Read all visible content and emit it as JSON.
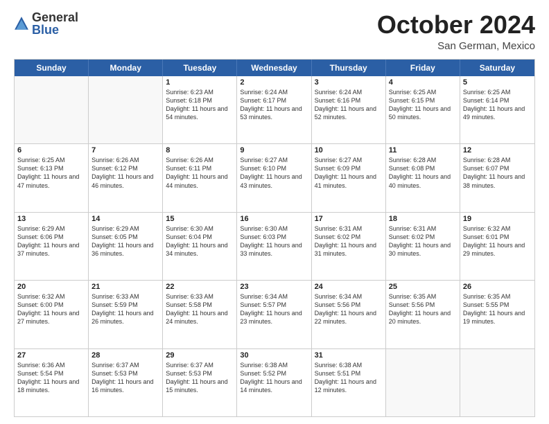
{
  "header": {
    "logo_general": "General",
    "logo_blue": "Blue",
    "month": "October 2024",
    "location": "San German, Mexico"
  },
  "weekdays": [
    "Sunday",
    "Monday",
    "Tuesday",
    "Wednesday",
    "Thursday",
    "Friday",
    "Saturday"
  ],
  "rows": [
    [
      {
        "day": "",
        "text": ""
      },
      {
        "day": "",
        "text": ""
      },
      {
        "day": "1",
        "text": "Sunrise: 6:23 AM\nSunset: 6:18 PM\nDaylight: 11 hours and 54 minutes."
      },
      {
        "day": "2",
        "text": "Sunrise: 6:24 AM\nSunset: 6:17 PM\nDaylight: 11 hours and 53 minutes."
      },
      {
        "day": "3",
        "text": "Sunrise: 6:24 AM\nSunset: 6:16 PM\nDaylight: 11 hours and 52 minutes."
      },
      {
        "day": "4",
        "text": "Sunrise: 6:25 AM\nSunset: 6:15 PM\nDaylight: 11 hours and 50 minutes."
      },
      {
        "day": "5",
        "text": "Sunrise: 6:25 AM\nSunset: 6:14 PM\nDaylight: 11 hours and 49 minutes."
      }
    ],
    [
      {
        "day": "6",
        "text": "Sunrise: 6:25 AM\nSunset: 6:13 PM\nDaylight: 11 hours and 47 minutes."
      },
      {
        "day": "7",
        "text": "Sunrise: 6:26 AM\nSunset: 6:12 PM\nDaylight: 11 hours and 46 minutes."
      },
      {
        "day": "8",
        "text": "Sunrise: 6:26 AM\nSunset: 6:11 PM\nDaylight: 11 hours and 44 minutes."
      },
      {
        "day": "9",
        "text": "Sunrise: 6:27 AM\nSunset: 6:10 PM\nDaylight: 11 hours and 43 minutes."
      },
      {
        "day": "10",
        "text": "Sunrise: 6:27 AM\nSunset: 6:09 PM\nDaylight: 11 hours and 41 minutes."
      },
      {
        "day": "11",
        "text": "Sunrise: 6:28 AM\nSunset: 6:08 PM\nDaylight: 11 hours and 40 minutes."
      },
      {
        "day": "12",
        "text": "Sunrise: 6:28 AM\nSunset: 6:07 PM\nDaylight: 11 hours and 38 minutes."
      }
    ],
    [
      {
        "day": "13",
        "text": "Sunrise: 6:29 AM\nSunset: 6:06 PM\nDaylight: 11 hours and 37 minutes."
      },
      {
        "day": "14",
        "text": "Sunrise: 6:29 AM\nSunset: 6:05 PM\nDaylight: 11 hours and 36 minutes."
      },
      {
        "day": "15",
        "text": "Sunrise: 6:30 AM\nSunset: 6:04 PM\nDaylight: 11 hours and 34 minutes."
      },
      {
        "day": "16",
        "text": "Sunrise: 6:30 AM\nSunset: 6:03 PM\nDaylight: 11 hours and 33 minutes."
      },
      {
        "day": "17",
        "text": "Sunrise: 6:31 AM\nSunset: 6:02 PM\nDaylight: 11 hours and 31 minutes."
      },
      {
        "day": "18",
        "text": "Sunrise: 6:31 AM\nSunset: 6:02 PM\nDaylight: 11 hours and 30 minutes."
      },
      {
        "day": "19",
        "text": "Sunrise: 6:32 AM\nSunset: 6:01 PM\nDaylight: 11 hours and 29 minutes."
      }
    ],
    [
      {
        "day": "20",
        "text": "Sunrise: 6:32 AM\nSunset: 6:00 PM\nDaylight: 11 hours and 27 minutes."
      },
      {
        "day": "21",
        "text": "Sunrise: 6:33 AM\nSunset: 5:59 PM\nDaylight: 11 hours and 26 minutes."
      },
      {
        "day": "22",
        "text": "Sunrise: 6:33 AM\nSunset: 5:58 PM\nDaylight: 11 hours and 24 minutes."
      },
      {
        "day": "23",
        "text": "Sunrise: 6:34 AM\nSunset: 5:57 PM\nDaylight: 11 hours and 23 minutes."
      },
      {
        "day": "24",
        "text": "Sunrise: 6:34 AM\nSunset: 5:56 PM\nDaylight: 11 hours and 22 minutes."
      },
      {
        "day": "25",
        "text": "Sunrise: 6:35 AM\nSunset: 5:56 PM\nDaylight: 11 hours and 20 minutes."
      },
      {
        "day": "26",
        "text": "Sunrise: 6:35 AM\nSunset: 5:55 PM\nDaylight: 11 hours and 19 minutes."
      }
    ],
    [
      {
        "day": "27",
        "text": "Sunrise: 6:36 AM\nSunset: 5:54 PM\nDaylight: 11 hours and 18 minutes."
      },
      {
        "day": "28",
        "text": "Sunrise: 6:37 AM\nSunset: 5:53 PM\nDaylight: 11 hours and 16 minutes."
      },
      {
        "day": "29",
        "text": "Sunrise: 6:37 AM\nSunset: 5:53 PM\nDaylight: 11 hours and 15 minutes."
      },
      {
        "day": "30",
        "text": "Sunrise: 6:38 AM\nSunset: 5:52 PM\nDaylight: 11 hours and 14 minutes."
      },
      {
        "day": "31",
        "text": "Sunrise: 6:38 AM\nSunset: 5:51 PM\nDaylight: 11 hours and 12 minutes."
      },
      {
        "day": "",
        "text": ""
      },
      {
        "day": "",
        "text": ""
      }
    ]
  ]
}
